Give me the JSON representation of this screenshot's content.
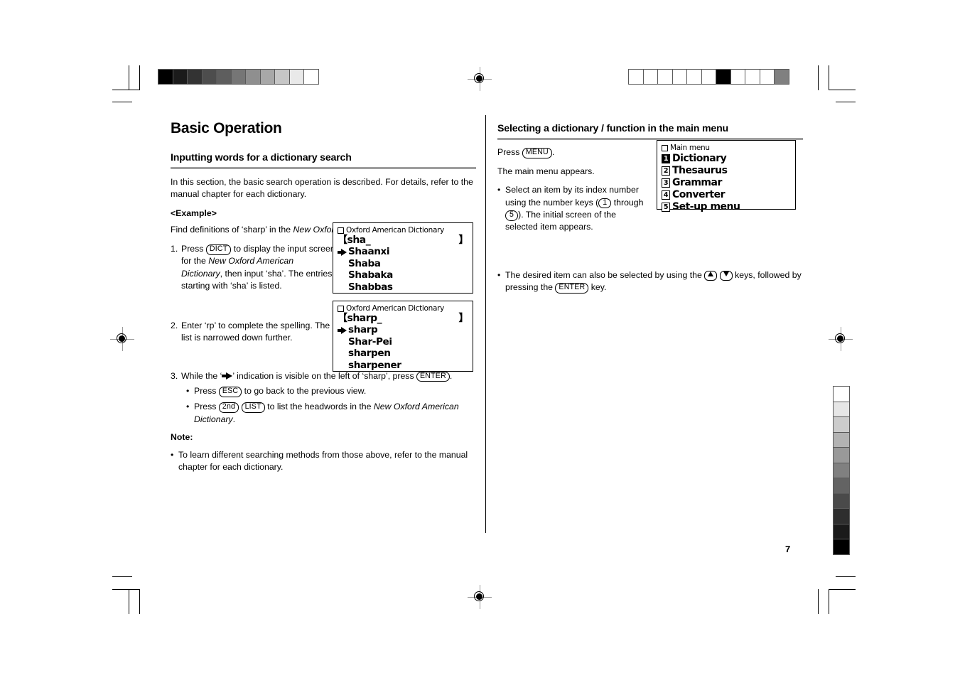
{
  "page": {
    "number": "7"
  },
  "left_column": {
    "chapter_title": "Basic Operation",
    "section_heading": "Inputting words for a dictionary search",
    "intro": "In this section, the basic search operation is described. For details, refer to the manual chapter for each dictionary.",
    "example_label": "<Example>",
    "example_text_1": "Find definitions of ‘sharp’ in the ",
    "example_italic": "New Oxford American Dictionary",
    "example_text_2": ".",
    "steps": [
      {
        "number": "1.",
        "text_a": "Press ",
        "key": "DICT",
        "text_b": " to display the input screen for the ",
        "italic_a": "New Oxford American Dictionary",
        "text_c": ", then input ‘sha’. The entries starting with ‘sha’ is listed."
      },
      {
        "number": "2.",
        "text_a": "Enter ‘rp’ to complete the spelling. The list is narrowed down further."
      },
      {
        "number": "3.",
        "text_a": "While the ‘",
        "arrow_icon": "right-arrow-icon",
        "text_b": "’ indication is visible on the left of ‘sharp’, press ",
        "key": "ENTER",
        "text_c": "."
      }
    ],
    "step3_bullets": [
      {
        "text_a": "Press ",
        "key_1": "ESC",
        "text_b": " to go back to the previous view."
      },
      {
        "text_a": "Press ",
        "key_1": "2nd",
        "key_2": "LIST",
        "text_b": " to list the headwords in the ",
        "italic": "New Oxford American Dictionary",
        "text_c": "."
      }
    ],
    "note_label": "Note:",
    "note_bullets": [
      "To learn different searching methods from those above, refer to the manual chapter for each dictionary."
    ]
  },
  "right_column": {
    "section_heading": "Selecting a dictionary / function in the main menu",
    "press_text_a": "Press ",
    "press_key": "MENU",
    "press_text_b": ".",
    "appears_text": "The main menu appears.",
    "bullets": [
      {
        "text_a": "Select an item by its index number using the number keys (",
        "key_1": "1",
        "text_b": " through ",
        "key_2": "5",
        "text_c": "). The initial screen of the selected item appears."
      },
      {
        "text_a": "The desired item can also be selected by using the ",
        "key_up": "up-arrow-key",
        "key_down": "down-arrow-key",
        "text_b": " keys, followed by pressing the ",
        "key_enter": "ENTER",
        "text_c": " key."
      }
    ]
  },
  "lcd_screens": {
    "screen_1": {
      "title": "Oxford American Dictionary",
      "input_left": "【sha_",
      "input_right": "】",
      "rows": [
        {
          "marked": true,
          "label": "Shaanxi"
        },
        {
          "marked": false,
          "label": "Shaba"
        },
        {
          "marked": false,
          "label": "Shabaka"
        },
        {
          "marked": false,
          "label": "Shabbas"
        }
      ]
    },
    "screen_2": {
      "title": "Oxford American Dictionary",
      "input_left": "【sharp_",
      "input_right": "】",
      "rows": [
        {
          "marked": true,
          "label": "sharp"
        },
        {
          "marked": false,
          "label": "Shar-Pei"
        },
        {
          "marked": false,
          "label": "sharpen"
        },
        {
          "marked": false,
          "label": "sharpener"
        }
      ]
    },
    "screen_3": {
      "title": "Main menu",
      "items": [
        {
          "index": "1",
          "label": "Dictionary",
          "selected": true
        },
        {
          "index": "2",
          "label": "Thesaurus",
          "selected": false
        },
        {
          "index": "3",
          "label": "Grammar",
          "selected": false
        },
        {
          "index": "4",
          "label": "Converter",
          "selected": false
        },
        {
          "index": "5",
          "label": "Set-up menu",
          "selected": false
        }
      ]
    }
  },
  "print_marks": {
    "grayscale_bar_top_left": [
      "#000000",
      "#1b1b1b",
      "#333333",
      "#4d4d4d",
      "#5e5e5e",
      "#767676",
      "#8f8f8f",
      "#a8a8a8",
      "#c6c6c6",
      "#e9e9e9",
      "#ffffff"
    ],
    "registration_bar_top_right": [
      "#ffffff",
      "#ffffff",
      "#ffffff",
      "#ffffff",
      "#ffffff",
      "#ffffff",
      "#000000",
      "#ffffff",
      "#ffffff",
      "#ffffff",
      "#808080"
    ],
    "grayscale_bar_right_vertical": [
      "#ffffff",
      "#e6e6e6",
      "#cccccc",
      "#b3b3b3",
      "#999999",
      "#808080",
      "#636363",
      "#4a4a4a",
      "#2e2e2e",
      "#1a1a1a",
      "#000000"
    ]
  }
}
